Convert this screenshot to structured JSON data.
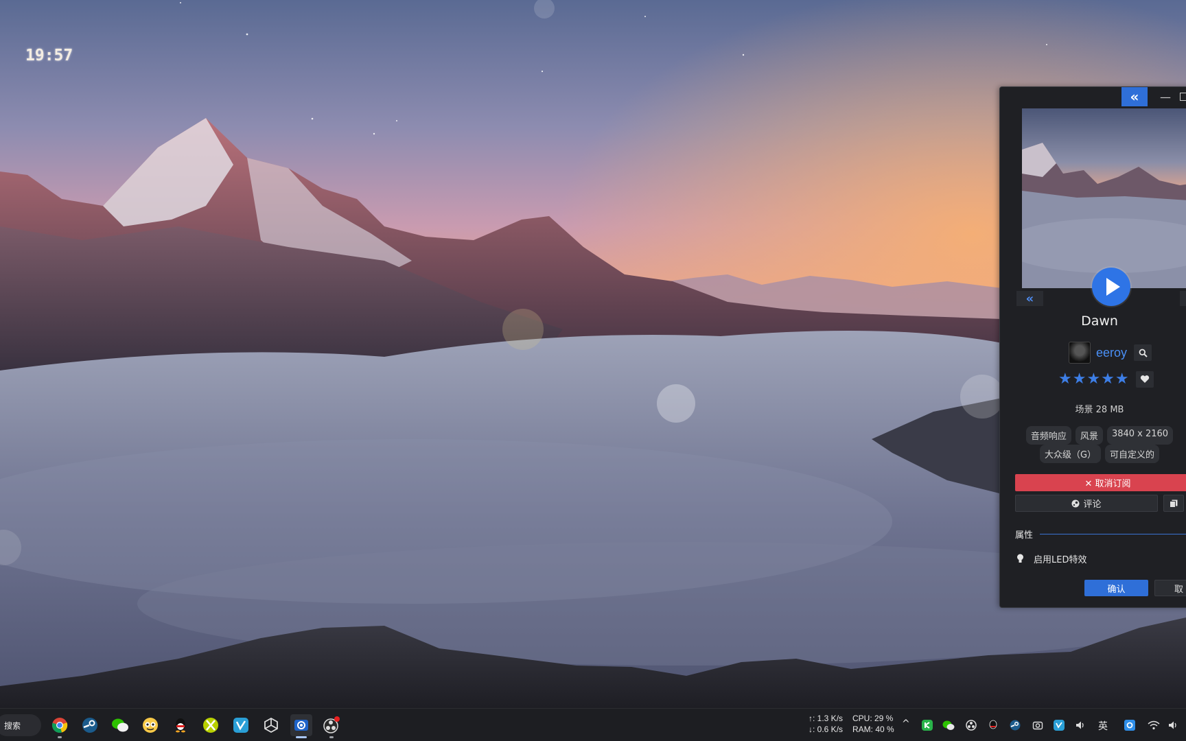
{
  "desktop": {
    "clock": "19:57",
    "wallpaper_name": "Dawn"
  },
  "panel": {
    "title": "Dawn",
    "author": "eeroy",
    "rating_stars": "★★★★★",
    "rating_value": 5,
    "rating_max": 5,
    "meta": "场景 28 MB",
    "tags_row1": [
      "音频响应",
      "风景",
      "3840 x 2160"
    ],
    "tags_row2": [
      "大众级（G）",
      "可自定义的"
    ],
    "unsubscribe_label": "✕ 取消订阅",
    "comment_label": "评论",
    "properties_title": "属性",
    "led_label": "启用LED特效",
    "ok_label": "确认",
    "cancel_label": "取",
    "collapse_icon": "«",
    "prev_icon": "«",
    "minimize_icon": "—",
    "accent": "#2f6fd8",
    "danger": "#d9434f"
  },
  "taskbar": {
    "search_label": "搜索",
    "apps": [
      "chrome-icon",
      "steam-icon",
      "wechat-icon",
      "qqmusic-icon",
      "qq-icon",
      "xbox-icon",
      "vscode-icon",
      "unity-icon",
      "wallpaper-engine-icon",
      "obs-icon"
    ],
    "net_up": "↑: 1.3 K/s",
    "net_down": "↓: 0.6 K/s",
    "cpu": "CPU: 29 %",
    "ram": "RAM: 40 %",
    "tray_chevron": "^",
    "ime": "英"
  }
}
